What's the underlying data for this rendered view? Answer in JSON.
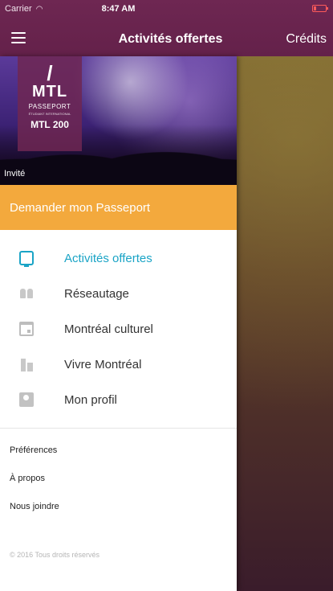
{
  "status_bar": {
    "carrier": "Carrier",
    "time": "8:47 AM"
  },
  "nav": {
    "title": "Activités offertes",
    "right_label": "Crédits"
  },
  "hero": {
    "logo_line1": "/",
    "logo_line2": "MTL",
    "logo_line3": "PASSEPORT",
    "logo_line4": "ÉTUDIANT INTERNATIONAL",
    "logo_line5": "MTL 200",
    "guest_label": "Invité"
  },
  "request_button": "Demander mon Passeport",
  "menu": {
    "items": [
      {
        "label": "Activités offertes",
        "icon": "screen-icon",
        "active": true
      },
      {
        "label": "Réseautage",
        "icon": "people-icon"
      },
      {
        "label": "Montréal culturel",
        "icon": "calendar-icon"
      },
      {
        "label": "Vivre Montréal",
        "icon": "city-icon"
      },
      {
        "label": "Mon profil",
        "icon": "profile-icon"
      }
    ]
  },
  "links": {
    "preferences": "Préférences",
    "about": "À propos",
    "contact": "Nous joindre"
  },
  "copyright": "© 2016 Tous droits réservés",
  "colors": {
    "header": "#6e2752",
    "accent": "#f3a93d",
    "active": "#1aa4c6"
  }
}
